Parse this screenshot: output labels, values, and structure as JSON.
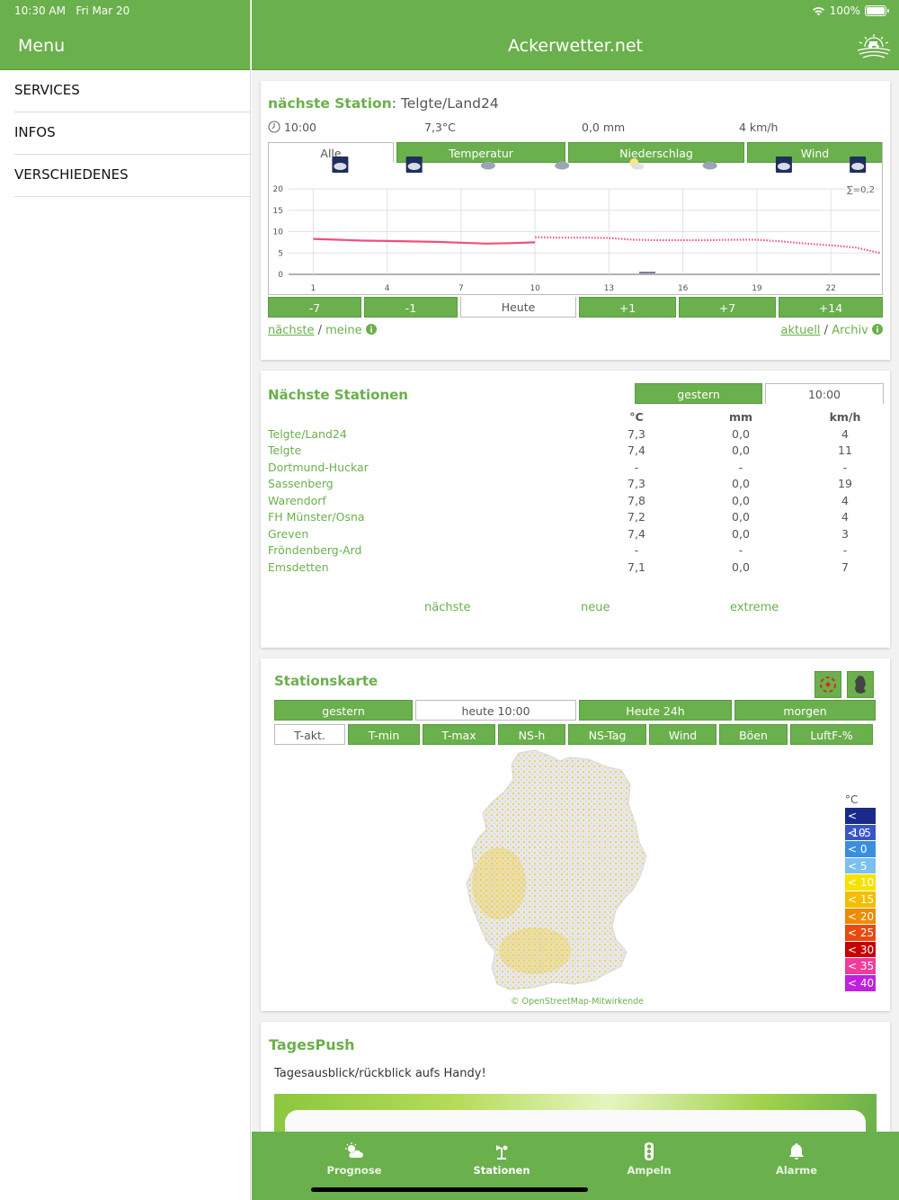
{
  "status": {
    "time": "10:30 AM",
    "date": "Fri Mar 20",
    "battery": "100%"
  },
  "sidebar": {
    "title": "Menu",
    "items": [
      {
        "label": "SERVICES"
      },
      {
        "label": "INFOS"
      },
      {
        "label": "VERSCHIEDENES"
      }
    ]
  },
  "header": {
    "title": "Ackerwetter.net"
  },
  "station_card": {
    "title_label": "nächste Station",
    "title_sep": ":",
    "station": "Telgte/Land24",
    "time": "10:00",
    "temp": "7,3°C",
    "rain": "0,0 mm",
    "wind": "4 km/h",
    "tabs": [
      "Alle",
      "Temperatur",
      "Niederschlag",
      "Wind"
    ],
    "sum_label": "∑=0,2",
    "day_buttons": [
      "-7",
      "-1",
      "Heute",
      "+1",
      "+7",
      "+14"
    ],
    "link_left_a": "nächste",
    "link_left_sep": " / ",
    "link_left_b": "meine",
    "link_right_a": "aktuell",
    "link_right_sep": " / ",
    "link_right_b": "Archiv"
  },
  "chart_data": {
    "type": "line",
    "x_ticks": [
      1,
      4,
      7,
      10,
      13,
      16,
      19,
      22
    ],
    "y_ticks": [
      0,
      5,
      10,
      15,
      20
    ],
    "ylim": [
      0,
      20
    ],
    "xlim": [
      0,
      24
    ],
    "series": [
      {
        "x": [
          1,
          2,
          3,
          4,
          5,
          6,
          7,
          8,
          9,
          10
        ],
        "values": [
          8.3,
          8.1,
          7.9,
          7.8,
          7.7,
          7.6,
          7.4,
          7.2,
          7.3,
          7.5
        ]
      },
      {
        "x": [
          10,
          11,
          12,
          13,
          14,
          15,
          16,
          17,
          18,
          19,
          20,
          21,
          22,
          23,
          24
        ],
        "values": [
          8.7,
          8.6,
          8.6,
          8.5,
          8.1,
          8.0,
          8.0,
          8.0,
          8.1,
          8.1,
          7.7,
          7.2,
          6.8,
          6.3,
          5.0
        ]
      }
    ]
  },
  "nearby": {
    "title": "Nächste Stationen",
    "tabs": [
      "gestern",
      "10:00"
    ],
    "headers": [
      "°C",
      "mm",
      "km/h"
    ],
    "rows": [
      {
        "name": "Telgte/Land24",
        "t": "7,3",
        "mm": "0,0",
        "kmh": "4"
      },
      {
        "name": "Telgte",
        "t": "7,4",
        "mm": "0,0",
        "kmh": "11"
      },
      {
        "name": "Dortmund-Huckar",
        "t": "-",
        "mm": "-",
        "kmh": "-"
      },
      {
        "name": "Sassenberg",
        "t": "7,3",
        "mm": "0,0",
        "kmh": "19"
      },
      {
        "name": "Warendorf",
        "t": "7,8",
        "mm": "0,0",
        "kmh": "4"
      },
      {
        "name": "FH Münster/Osna",
        "t": "7,2",
        "mm": "0,0",
        "kmh": "4"
      },
      {
        "name": "Greven",
        "t": "7,4",
        "mm": "0,0",
        "kmh": "3"
      },
      {
        "name": "Fröndenberg-Ard",
        "t": "-",
        "mm": "-",
        "kmh": "-"
      },
      {
        "name": "Emsdetten",
        "t": "7,1",
        "mm": "0,0",
        "kmh": "7"
      }
    ],
    "links": [
      "nächste",
      "neue",
      "extreme"
    ]
  },
  "map_card": {
    "title": "Stationskarte",
    "time_tabs": [
      "gestern",
      "heute 10:00",
      "Heute 24h",
      "morgen"
    ],
    "param_tabs": [
      "T-akt.",
      "T-min",
      "T-max",
      "NS-h",
      "NS-Tag",
      "Wind",
      "Böen",
      "LuftF-%"
    ],
    "credit": "© OpenStreetMap-Mitwirkende",
    "legend_unit": "°C",
    "legend": [
      {
        "label": "< -10",
        "color": "#1a2a8a"
      },
      {
        "label": "< -5",
        "color": "#3a55c8"
      },
      {
        "label": "< 0",
        "color": "#3a8ee0"
      },
      {
        "label": "< 5",
        "color": "#7cc0f0"
      },
      {
        "label": "< 10",
        "color": "#f6e200"
      },
      {
        "label": "< 15",
        "color": "#f5be00"
      },
      {
        "label": "< 20",
        "color": "#f08a00"
      },
      {
        "label": "< 25",
        "color": "#e84a10"
      },
      {
        "label": "< 30",
        "color": "#c80000"
      },
      {
        "label": "< 35",
        "color": "#f03c9c"
      },
      {
        "label": "< 40",
        "color": "#c020e0"
      }
    ]
  },
  "push_card": {
    "title": "TagesPush",
    "subtitle": "Tagesausblick/rückblick aufs Handy!"
  },
  "tabbar": {
    "items": [
      {
        "label": "Prognose"
      },
      {
        "label": "Stationen"
      },
      {
        "label": "Ampeln"
      },
      {
        "label": "Alarme"
      }
    ]
  },
  "colors": {
    "accent": "#6ab04c",
    "chart_line": "#f0507a"
  }
}
